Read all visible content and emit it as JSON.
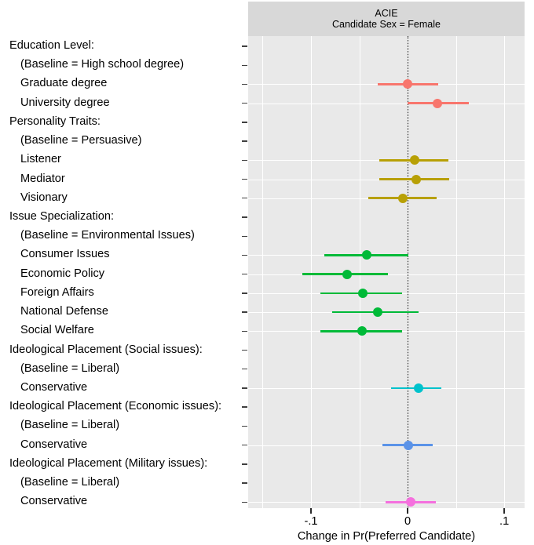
{
  "figure": {
    "panel_title_line1": "ACIE",
    "panel_title_line2": "Candidate Sex = Female"
  },
  "axis": {
    "x_title": "Change in Pr(Preferred Candidate)",
    "x_ticks": [
      "-.1",
      "0",
      ".1"
    ],
    "x_tick_values": [
      -0.1,
      0,
      0.1
    ],
    "x_min": -0.165,
    "x_max": 0.121,
    "reference_line": 0
  },
  "colors": {
    "education": "#F8766D",
    "personality": "#B8A005",
    "issue": "#00BA38",
    "ideology_social": "#00C2CC",
    "ideology_economic": "#5B93E8",
    "ideology_military": "#F570DE",
    "panel_background": "#e9e9e9",
    "title_background": "#d8d8d8",
    "grid": "#ffffff",
    "text": "#000000"
  },
  "chart_data": {
    "type": "scatter",
    "title": "ACIE — Candidate Sex = Female",
    "subtitle": "Candidate Sex = Female",
    "xlabel": "Change in Pr(Preferred Candidate)",
    "ylabel": "",
    "xlim": [
      -0.165,
      0.121
    ],
    "grid": true,
    "legend": "none",
    "reference_line_x": 0,
    "rows": [
      {
        "label": "Education Level:",
        "type": "header",
        "indent": 0
      },
      {
        "label": "(Baseline = High school degree)",
        "type": "baseline",
        "indent": 1
      },
      {
        "label": "Graduate degree",
        "type": "estimate",
        "indent": 1,
        "group": "education",
        "estimate": 0.0,
        "ci_low": -0.031,
        "ci_high": 0.032
      },
      {
        "label": "University degree",
        "type": "estimate",
        "indent": 1,
        "group": "education",
        "estimate": 0.031,
        "ci_low": 0.0,
        "ci_high": 0.063
      },
      {
        "label": "Personality Traits:",
        "type": "header",
        "indent": 0
      },
      {
        "label": "(Baseline = Persuasive)",
        "type": "baseline",
        "indent": 1
      },
      {
        "label": "Listener",
        "type": "estimate",
        "indent": 1,
        "group": "personality",
        "estimate": 0.007,
        "ci_low": -0.029,
        "ci_high": 0.042
      },
      {
        "label": "Mediator",
        "type": "estimate",
        "indent": 1,
        "group": "personality",
        "estimate": 0.009,
        "ci_low": -0.029,
        "ci_high": 0.043
      },
      {
        "label": "Visionary",
        "type": "estimate",
        "indent": 1,
        "group": "personality",
        "estimate": -0.005,
        "ci_low": -0.041,
        "ci_high": 0.03
      },
      {
        "label": "Issue Specialization:",
        "type": "header",
        "indent": 0
      },
      {
        "label": "(Baseline = Environmental Issues)",
        "type": "baseline",
        "indent": 1
      },
      {
        "label": "Consumer Issues",
        "type": "estimate",
        "indent": 1,
        "group": "issue",
        "estimate": -0.042,
        "ci_low": -0.086,
        "ci_high": 0.001
      },
      {
        "label": "Economic Policy",
        "type": "estimate",
        "indent": 1,
        "group": "issue",
        "estimate": -0.063,
        "ci_low": -0.109,
        "ci_high": -0.02
      },
      {
        "label": "Foreign Affairs",
        "type": "estimate",
        "indent": 1,
        "group": "issue",
        "estimate": -0.046,
        "ci_low": -0.09,
        "ci_high": -0.006
      },
      {
        "label": "National Defense",
        "type": "estimate",
        "indent": 1,
        "group": "issue",
        "estimate": -0.031,
        "ci_low": -0.078,
        "ci_high": 0.011
      },
      {
        "label": "Social Welfare",
        "type": "estimate",
        "indent": 1,
        "group": "issue",
        "estimate": -0.047,
        "ci_low": -0.09,
        "ci_high": -0.006
      },
      {
        "label": "Ideological Placement (Social issues):",
        "type": "header",
        "indent": 0
      },
      {
        "label": "(Baseline = Liberal)",
        "type": "baseline",
        "indent": 1
      },
      {
        "label": "Conservative",
        "type": "estimate",
        "indent": 1,
        "group": "ideology_social",
        "estimate": 0.011,
        "ci_low": -0.017,
        "ci_high": 0.035
      },
      {
        "label": "Ideological Placement (Economic issues):",
        "type": "header",
        "indent": 0
      },
      {
        "label": "(Baseline = Liberal)",
        "type": "baseline",
        "indent": 1
      },
      {
        "label": "Conservative",
        "type": "estimate",
        "indent": 1,
        "group": "ideology_economic",
        "estimate": 0.001,
        "ci_low": -0.026,
        "ci_high": 0.026
      },
      {
        "label": "Ideological Placement (Military issues):",
        "type": "header",
        "indent": 0
      },
      {
        "label": "(Baseline = Liberal)",
        "type": "baseline",
        "indent": 1
      },
      {
        "label": "Conservative",
        "type": "estimate",
        "indent": 1,
        "group": "ideology_military",
        "estimate": 0.003,
        "ci_low": -0.023,
        "ci_high": 0.029
      }
    ]
  }
}
